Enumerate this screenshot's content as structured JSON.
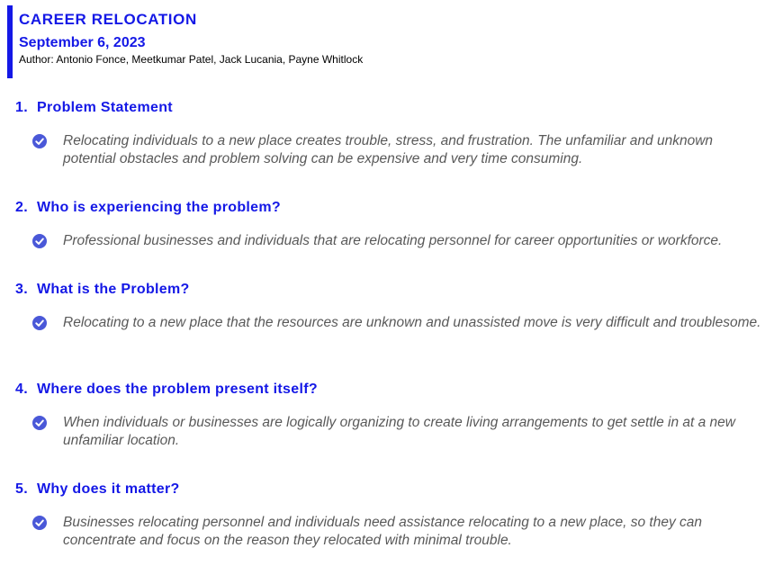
{
  "header": {
    "title": "CAREER RELOCATION",
    "date": "September 6, 2023",
    "author": "Author: Antonio Fonce, Meetkumar Patel, Jack Lucania, Payne Whitlock"
  },
  "colors": {
    "accent": "#1418e6",
    "bullet": "#4a58d8",
    "body_text": "#595959"
  },
  "icons": {
    "bullet": "check-circle-icon"
  },
  "sections": [
    {
      "number": "1.",
      "heading": "Problem Statement",
      "text": "Relocating individuals to a new place creates trouble, stress, and frustration. The unfamiliar and unknown potential obstacles and problem solving can be expensive and very time consuming."
    },
    {
      "number": "2.",
      "heading": "Who is experiencing the problem?",
      "text": "Professional businesses and individuals that are relocating personnel for career opportunities or workforce."
    },
    {
      "number": "3.",
      "heading": "What is the Problem?",
      "text": "Relocating to a new place that the resources are unknown and unassisted move is very difficult and troublesome."
    },
    {
      "number": "4.",
      "heading": "Where does the problem present itself?",
      "text": "When individuals or businesses are logically organizing to create living arrangements to get settle in at a new unfamiliar location."
    },
    {
      "number": "5.",
      "heading": "Why does it matter?",
      "text": "Businesses relocating personnel and individuals need assistance relocating to a new place, so they can concentrate and focus on the reason they relocated with minimal trouble."
    }
  ]
}
